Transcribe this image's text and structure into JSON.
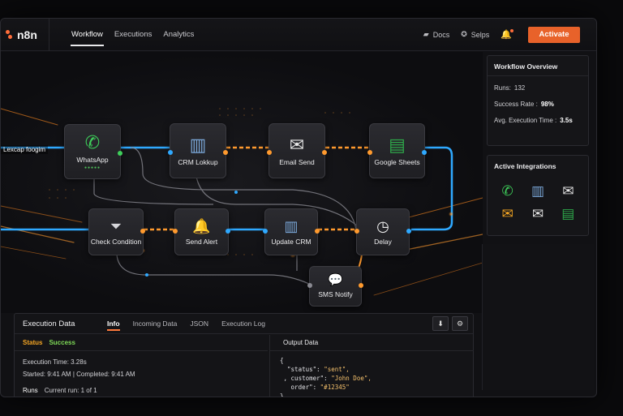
{
  "app": {
    "logo": "n8n"
  },
  "nav": [
    {
      "label": "Workflow",
      "active": true
    },
    {
      "label": "Executions",
      "active": false
    },
    {
      "label": "Analytics",
      "active": false
    }
  ],
  "topbar": {
    "docs": "Docs",
    "help": "Selps",
    "activate": "Activate"
  },
  "canvas": {
    "cut_label": "Lexcap foogim"
  },
  "nodes": {
    "whatsapp": {
      "label": "WhatsApp",
      "icon": "whatsapp-icon"
    },
    "crm_lookup": {
      "label": "CRM Lokkup",
      "icon": "crm-icon"
    },
    "email_send": {
      "label": "Email Send",
      "icon": "envelope-icon"
    },
    "google_sheets": {
      "label": "Google Sheets",
      "icon": "sheets-icon"
    },
    "check_condition": {
      "label": "Check Condition",
      "icon": "filter-icon"
    },
    "send_alert": {
      "label": "Send Alert",
      "icon": "bell-icon"
    },
    "update_crm": {
      "label": "Update CRM",
      "icon": "crm-icon"
    },
    "delay": {
      "label": "Delay",
      "icon": "clock-icon"
    },
    "sms_notify": {
      "label": "SMS Notify",
      "icon": "chat-icon"
    }
  },
  "overview": {
    "title": "Workflow Overview",
    "runs_label": "Runs:",
    "runs_value": "132",
    "success_label": "Success Rate :",
    "success_value": "98%",
    "avg_label": "Avg. Execution Time :",
    "avg_value": "3.5s"
  },
  "integrations": {
    "title": "Active Integrations",
    "icons": [
      "whatsapp-icon",
      "crm-icon",
      "envelope-icon",
      "envelope-orange-icon",
      "envelope-icon",
      "sheets-icon"
    ]
  },
  "execution": {
    "title": "Execution Data",
    "tabs": [
      {
        "label": "Info",
        "active": true
      },
      {
        "label": "Incoming Data",
        "active": false
      },
      {
        "label": "JSON",
        "active": false
      },
      {
        "label": "Execution Log",
        "active": false
      }
    ],
    "status_label": "Status",
    "status_value": "Success",
    "exec_time": "Execution Time:  3.28s",
    "started": "Started:  9:41 AM  |  Completed: 9:41 AM",
    "runs_label": "Runs",
    "runs_value": "Current run:  1 of 1",
    "output_title": "Output Data",
    "code": {
      "open": "{",
      "status_key": "  \"status\": ",
      "status_val": "\"sent\",",
      "customer_key": " , customer\": ",
      "customer_val": "\"John Doe\",",
      "order_key": "   order\": ",
      "order_val": "\"#12345\"",
      "close": "},"
    }
  },
  "colors": {
    "accent": "#e8622a",
    "wire_blue": "#2fa9ff",
    "wire_orange": "#ff9a2e",
    "success": "#7ed957",
    "status": "#f5a623"
  }
}
